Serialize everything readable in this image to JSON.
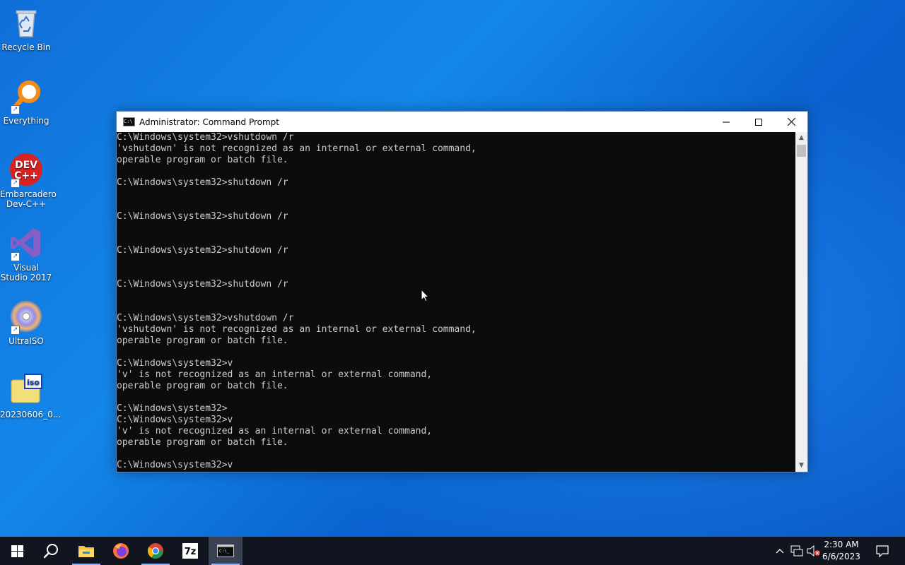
{
  "desktop": {
    "icons": [
      {
        "label": "Recycle Bin"
      },
      {
        "label": "Everything"
      },
      {
        "label": "Embarcadero Dev-C++"
      },
      {
        "label": "Visual Studio 2017"
      },
      {
        "label": "UltraISO"
      },
      {
        "label": "20230606_0..."
      }
    ]
  },
  "window": {
    "title": "Administrator:  Command Prompt",
    "icon": "cmd-icon",
    "controls": [
      "minimize",
      "maximize",
      "close"
    ],
    "console_lines": [
      "C:\\Windows\\system32>vshutdown /r",
      "'vshutdown' is not recognized as an internal or external command,",
      "operable program or batch file.",
      "",
      "C:\\Windows\\system32>shutdown /r",
      "",
      "",
      "C:\\Windows\\system32>shutdown /r",
      "",
      "",
      "C:\\Windows\\system32>shutdown /r",
      "",
      "",
      "C:\\Windows\\system32>shutdown /r",
      "",
      "",
      "C:\\Windows\\system32>vshutdown /r",
      "'vshutdown' is not recognized as an internal or external command,",
      "operable program or batch file.",
      "",
      "C:\\Windows\\system32>v",
      "'v' is not recognized as an internal or external command,",
      "operable program or batch file.",
      "",
      "C:\\Windows\\system32>",
      "C:\\Windows\\system32>v",
      "'v' is not recognized as an internal or external command,",
      "operable program or batch file.",
      "",
      "C:\\Windows\\system32>v"
    ]
  },
  "taskbar": {
    "apps": [
      "start",
      "search",
      "file-explorer",
      "firefox",
      "chrome",
      "7-zip",
      "command-prompt"
    ],
    "active_app": "command-prompt",
    "clock": {
      "time": "2:30 AM",
      "date": "6/6/2023"
    }
  },
  "colors": {
    "accent": "#0078d7",
    "console_bg": "#0c0c0c",
    "console_fg": "#cccccc",
    "taskbar": "#101520"
  }
}
